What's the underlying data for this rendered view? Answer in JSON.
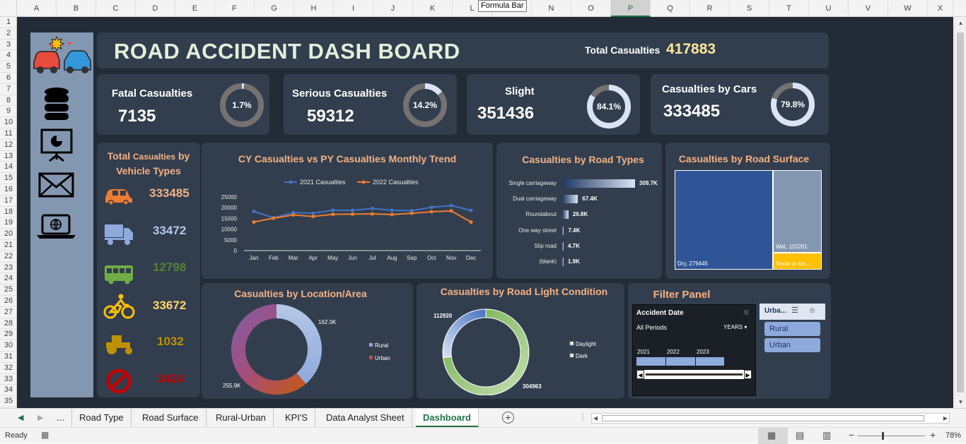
{
  "spreadsheet": {
    "columns": [
      "A",
      "B",
      "C",
      "D",
      "E",
      "F",
      "G",
      "H",
      "I",
      "J",
      "K",
      "L",
      "M",
      "N",
      "O",
      "P",
      "Q",
      "R",
      "S",
      "T",
      "U",
      "V",
      "W",
      "X"
    ],
    "rows": [
      "1",
      "2",
      "3",
      "4",
      "5",
      "6",
      "7",
      "8",
      "9",
      "10",
      "11",
      "12",
      "13",
      "14",
      "15",
      "16",
      "17",
      "18",
      "19",
      "20",
      "21",
      "22",
      "23",
      "24",
      "25",
      "26",
      "27",
      "28",
      "29",
      "30",
      "31",
      "32",
      "33",
      "34",
      "35"
    ],
    "selected_column": "P",
    "tooltip": "Formula Bar"
  },
  "dashboard": {
    "title": "ROAD ACCIDENT DASH BOARD",
    "total_label": "Total Casualties",
    "total_value": "417883"
  },
  "sidebar_icons": [
    "car-crash-icon",
    "database-icon",
    "presentation-icon",
    "mail-icon",
    "laptop-globe-icon"
  ],
  "kpis": [
    {
      "label": "Fatal Casualties",
      "value": "7135",
      "pct": "1.7%",
      "fraction": 0.017
    },
    {
      "label": "Serious Casualties",
      "value": "59312",
      "pct": "14.2%",
      "fraction": 0.142
    },
    {
      "label": "Slight",
      "value": "351436",
      "pct": "84.1%",
      "fraction": 0.841
    },
    {
      "label": "Casualties by Cars",
      "value": "333485",
      "pct": "79.8%",
      "fraction": 0.798
    }
  ],
  "vehicle": {
    "title_part1": "Total",
    "title_part2": "Casualties",
    "title_part3": "by",
    "title_line2": "Vehicle Types",
    "items": [
      {
        "icon": "car-icon",
        "value": "333485",
        "color": "#f4b183",
        "icon_color": "#ed7d31"
      },
      {
        "icon": "truck-icon",
        "value": "33472",
        "color": "#b4c7e7",
        "icon_color": "#8ea9db"
      },
      {
        "icon": "bus-icon",
        "value": "12798",
        "color": "#548235",
        "icon_color": "#70ad47"
      },
      {
        "icon": "bicycle-icon",
        "value": "33672",
        "color": "#ffd966",
        "icon_color": "#ffc000"
      },
      {
        "icon": "tractor-icon",
        "value": "1032",
        "color": "#bf9000",
        "icon_color": "#bf9000"
      },
      {
        "icon": "prohibited-icon",
        "value": "3424",
        "color": "#c00000",
        "icon_color": "#c00000"
      }
    ]
  },
  "trend_chart": {
    "chart_data": {
      "type": "line",
      "title": "CY Casualties vs PY Casualties Monthly Trend",
      "categories": [
        "Jan",
        "Feb",
        "Mar",
        "Apr",
        "May",
        "Jun",
        "Jul",
        "Aug",
        "Sep",
        "Oct",
        "Nov",
        "Dec"
      ],
      "ylim": [
        0,
        25000
      ],
      "yticks": [
        "0",
        "5000",
        "10000",
        "15000",
        "20000",
        "25000"
      ],
      "legend": "top",
      "series": [
        {
          "name": "2021 Casualties",
          "color": "#4472c4",
          "values": [
            18300,
            15300,
            17700,
            17400,
            18800,
            18800,
            19600,
            18800,
            18600,
            20200,
            21000,
            18700
          ]
        },
        {
          "name": "2022 Casualties",
          "color": "#ed7d31",
          "values": [
            13300,
            15100,
            16600,
            15900,
            16900,
            17000,
            17100,
            16800,
            17400,
            18100,
            18500,
            13300
          ]
        }
      ]
    }
  },
  "road_types": {
    "chart_data": {
      "type": "bar",
      "title": "Casualties by Road Types",
      "categories": [
        "Single carriageway",
        "Dual carriageway",
        "Roundabout",
        "One way street",
        "Slip road",
        "(blank)"
      ],
      "values": [
        309.7,
        67.4,
        26.8,
        7.4,
        4.7,
        1.9
      ],
      "labels": [
        "309.7K",
        "67.4K",
        "26.8K",
        "7.4K",
        "4.7K",
        "1.9K"
      ]
    }
  },
  "road_surface": {
    "chart_data": {
      "type": "treemap",
      "title": "Casualties  by Road Surface",
      "categories": [
        "Dry",
        "Wet",
        "Snow or ice,..."
      ],
      "values": [
        279445,
        115261,
        23177
      ],
      "labels": [
        "Dry, 279445",
        "Wet, 115261",
        "Snow or ice,..."
      ],
      "colors": [
        "#2f5597",
        "#8497b0",
        "#ffc000"
      ]
    }
  },
  "location": {
    "chart_data": {
      "type": "pie",
      "title": "Casualties by Location/Area",
      "categories": [
        "Rural",
        "Urban"
      ],
      "values": [
        162.0,
        255.9
      ],
      "labels": [
        "162.0K",
        "255.9K"
      ],
      "legend": "right"
    }
  },
  "light": {
    "chart_data": {
      "type": "pie",
      "title": "Casualties by Road Light Condition",
      "categories": [
        "Daylight",
        "Dark"
      ],
      "values": [
        304963,
        112920
      ],
      "labels": [
        "304963",
        "112920"
      ],
      "legend": "right"
    }
  },
  "filter": {
    "title": "Filter Panel",
    "date_header": "Accident Date",
    "all_periods": "All Periods",
    "years_label": "YEARS",
    "years": [
      "2021",
      "2022",
      "2023"
    ],
    "area_header": "Urba...",
    "area_options": [
      "Rural",
      "Urban"
    ]
  },
  "sheet_tabs": {
    "ellipsis": "...",
    "tabs": [
      "Road Type",
      "Road Surface",
      "Rural-Urban",
      "KPI'S",
      "Data Analyst Sheet",
      "Dashboard"
    ],
    "active": "Dashboard"
  },
  "status_bar": {
    "ready": "Ready",
    "zoom": "78%"
  }
}
